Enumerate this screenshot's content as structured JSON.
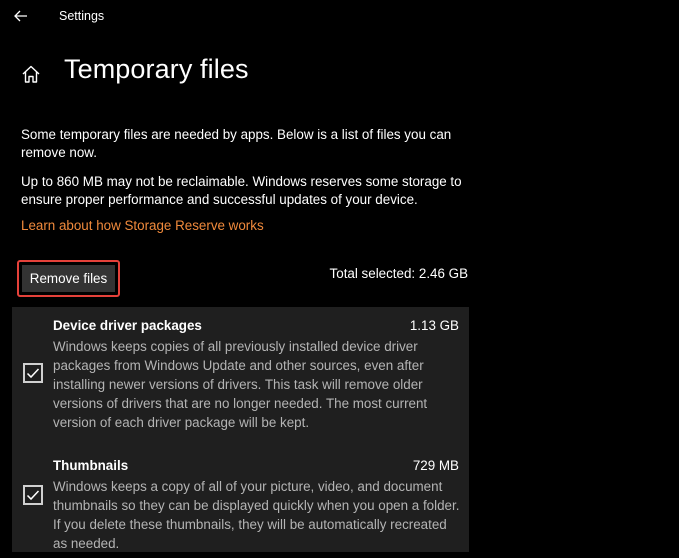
{
  "window": {
    "title": "Settings",
    "back_icon": "arrow-left-icon"
  },
  "header": {
    "home_icon": "home-icon",
    "title": "Temporary files"
  },
  "intro": {
    "p1": "Some temporary files are needed by apps. Below is a list of files you can remove now.",
    "p2": "Up to 860 MB may not be reclaimable. Windows reserves some storage to ensure proper performance and successful updates of your device.",
    "link": "Learn about how Storage Reserve works"
  },
  "actions": {
    "remove_label": "Remove files",
    "total_selected": "Total selected: 2.46 GB"
  },
  "items": [
    {
      "name": "Device driver packages",
      "size": "1.13 GB",
      "checked": true,
      "description": "Windows keeps copies of all previously installed device driver packages from Windows Update and other sources, even after installing newer versions of drivers. This task will remove older versions of drivers that are no longer needed. The most current version of each driver package will be kept."
    },
    {
      "name": "Thumbnails",
      "size": "729 MB",
      "checked": true,
      "description": "Windows keeps a copy of all of your picture, video, and document thumbnails so they can be displayed quickly when you open a folder. If you delete these thumbnails, they will be automatically recreated as needed."
    }
  ],
  "colors": {
    "background": "#000000",
    "link": "#f08a3c",
    "highlight": "#e5413a",
    "panel": "#1f1f1f",
    "button": "#333333"
  }
}
